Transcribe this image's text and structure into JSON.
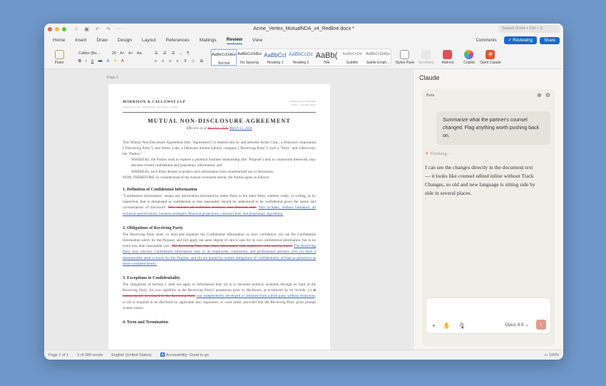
{
  "window": {
    "title": "Acme_Vertex_MutualNDA_v4_Redline.docx *",
    "search_placeholder": "Search (Cmd + Ctrl + I)",
    "traffic": [
      "#ec5f57",
      "#f4bd2f",
      "#5ec73f"
    ]
  },
  "tabs": [
    "Home",
    "Insert",
    "Draw",
    "Design",
    "Layout",
    "References",
    "Mailings",
    "Review",
    "View"
  ],
  "active_tab": "Review",
  "tab_actions": {
    "comments": "Comments",
    "reviewing": "✓ Reviewing",
    "share": "Share"
  },
  "ribbon": {
    "paste": "Paste",
    "font": "Calibri (Bo...",
    "size": "26",
    "styles": [
      {
        "preview": "AaBbCcDdEe",
        "name": "Normal"
      },
      {
        "preview": "AaBbCcDdEe",
        "name": "No Spacing"
      },
      {
        "preview": "AaBbCcI",
        "name": "Heading 1"
      },
      {
        "preview": "AaBbCcDc",
        "name": "Heading 2"
      },
      {
        "preview": "AaBb(",
        "name": "Title"
      },
      {
        "preview": "AaBbCcDd",
        "name": "Subtitle"
      },
      {
        "preview": "AaBbCcDdEe",
        "name": "Subtle Emph..."
      }
    ],
    "buttons": [
      {
        "label": "Styles Pane",
        "color": "#ffffff"
      },
      {
        "label": "Sensitivity",
        "color": "#e8e8e8"
      },
      {
        "label": "Add-ins",
        "color": "#e0505a"
      },
      {
        "label": "Copilot",
        "color": "#7b5cf0"
      },
      {
        "label": "Open Claude",
        "color": "#e0552e"
      }
    ]
  },
  "doc": {
    "page_label": "Page 1",
    "firm": "MORRISON & CALLOWAY LLP",
    "firm_sub": "Attorneys at Law · 500 Boylston · New York · London",
    "header_right": [
      "Privileged & Confidential",
      "Draft — For Discussion"
    ],
    "title": "MUTUAL NON-DISCLOSURE AGREEMENT",
    "effective_prefix": "Effective as of ",
    "effective_old": "March 1, 2026",
    "effective_new": "March 15, 2026",
    "intro": "This Mutual Non-Disclosure Agreement (this \"Agreement\") is entered into by and between Acme Corp., a Delaware corporation (\"Disclosing Party\"), and Vertex Labs, a Delaware limited liability company (\"Receiving Party\"), each a \"Party\" and collectively the \"Parties.\"",
    "whereas1": "WHEREAS, the Parties wish to explore a potential business relationship (the \"Purpose\") and, in connection therewith, may disclose certain confidential and proprietary information; and",
    "whereas2": "WHEREAS, each Party desires to protect such information from unauthorized use or disclosure;",
    "now": "NOW, THEREFORE, in consideration of the mutual covenants herein, the Parties agree as follows:",
    "s1_title": "1. Definition of Confidential Information",
    "s1_text": "\"Confidential Information\" means any information disclosed by either Party to the other Party, whether orally, in writing, or by inspection, that is designated as confidential or that reasonably should be understood to be confidential given the nature and circumstances of disclosure. ",
    "s1_del": "This includes all technical, business, and financial data.",
    "s1_ins": "This includes, without limitation, all technical specifications, business strategies, financial projections, customer lists, and proprietary algorithms.",
    "s2_title": "2. Obligations of Receiving Party",
    "s2_text": "The Receiving Party shall: (i) hold and maintain the Confidential Information in strict confidence; (ii) use the Confidential Information solely for the Purpose; and (iii) apply the same degree of care it uses for its own confidential information, but in no event less than reasonable care. ",
    "s2_del": "The Receiving Party may share information with employees who need to know.",
    "s2_ins": "The Receiving Party may disclose Confidential Information only to its employees, contractors, and professional advisors who (a) have a demonstrable need to know for the Purpose, and (b) are bound by written obligations of confidentiality at least as protective as those contained herein.",
    "s3_title": "3. Exceptions to Confidentiality",
    "s3_text": "The obligations of Section 2 shall not apply to information that: (a) is or becomes publicly available through no fault of the Receiving Party; (b) was rightfully in the Receiving Party's possession prior to disclosure, as evidenced by its records; (c) ",
    "s3_del": "is independently developed by the Receiving Party",
    "s3_ins": "was independently developed or obtained from a third party without restriction",
    "s3_text2": "; or (d) is required to be disclosed by applicable law, regulation, or court order, provided that the Receiving Party gives prompt written notice.",
    "s4_title": "4. Term and Termination"
  },
  "claude": {
    "title": "Claude",
    "beta": "Beta",
    "user_message": "Summarize what the partner's counsel changed. Flag anything worth pushing back on.",
    "thinking": "Thinking...",
    "response": "I can see the changes directly in the document text — it looks like counsel edited inline without Track Changes, so old and new language is sitting side by side in several places.",
    "model": "Opus 4.6",
    "accent": "#d97757"
  },
  "status": {
    "page": "Page 1 of 1",
    "words": "3 of 288 words",
    "language": "English (United States)",
    "accessibility": "Accessibility: Good to go",
    "zoom": "100%"
  }
}
